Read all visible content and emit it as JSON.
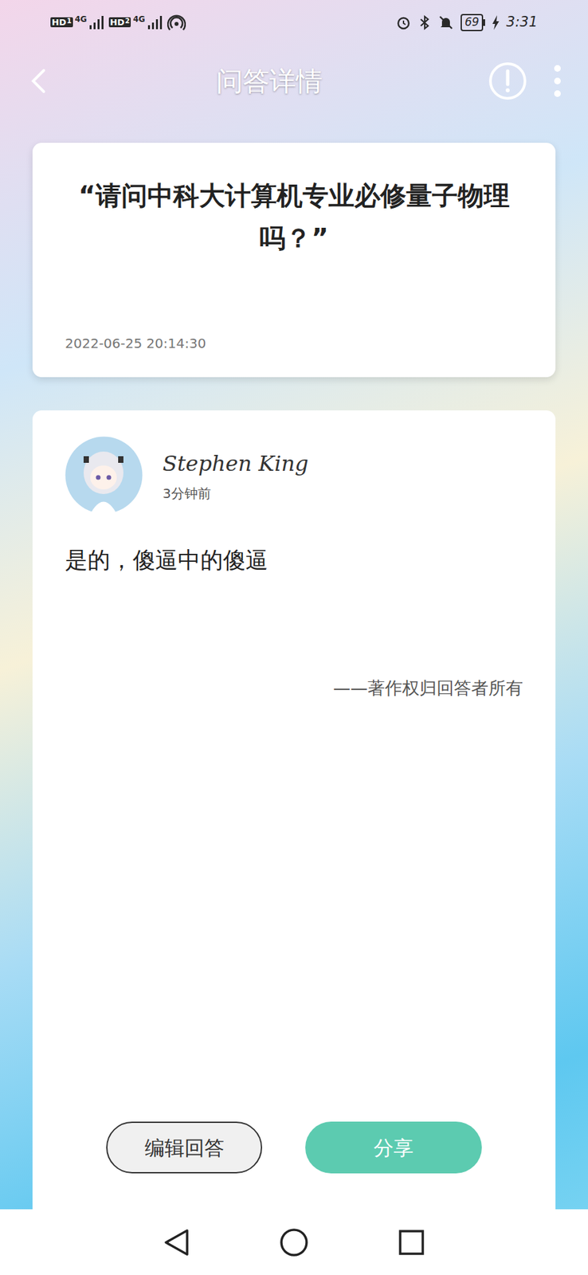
{
  "status_bar": {
    "sims": [
      {
        "hd": "HD",
        "slot": "1",
        "network": "4G"
      },
      {
        "hd": "HD",
        "slot": "2",
        "network": "4G"
      }
    ],
    "battery": "69",
    "time": "3:31"
  },
  "header": {
    "title": "问答详情"
  },
  "question": {
    "text": "“请问中科大计算机专业必修量子物理吗？”",
    "time": "2022-06-25 20:14:30"
  },
  "answer": {
    "author": "Stephen King",
    "time": "3分钟前",
    "text": "是的，傻逼中的傻逼",
    "copyright": "——著作权归回答者所有"
  },
  "buttons": [
    {
      "label": "编辑回答",
      "kind": "outline"
    },
    {
      "label": "分享",
      "kind": "filled"
    }
  ]
}
